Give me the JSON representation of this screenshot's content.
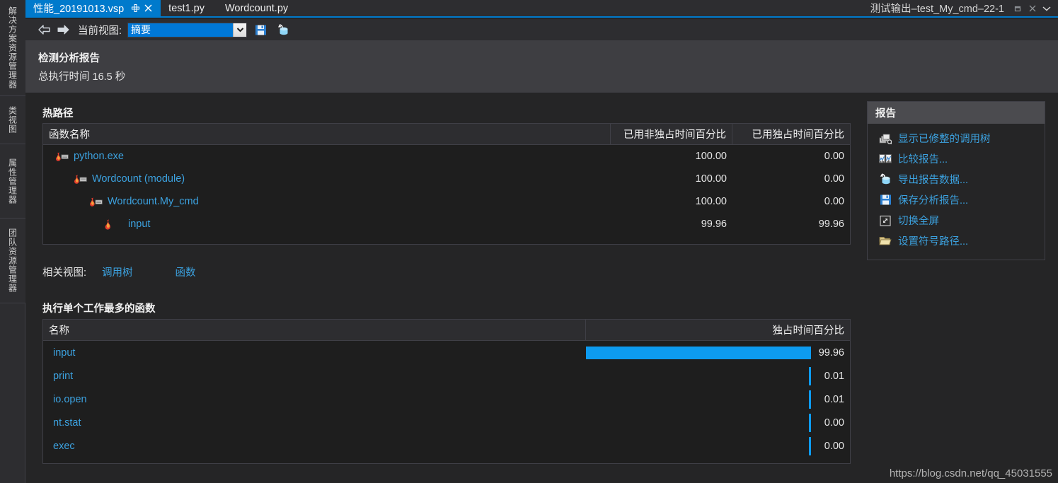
{
  "colors": {
    "accent": "#007acc",
    "link": "#3ca2e0",
    "bar": "#0d9bf0",
    "band": "#3e3e42",
    "content_bg": "#252526",
    "grid_bg": "#1e1e1e"
  },
  "left_dock": {
    "items": [
      {
        "label": "解决方案资源管理器",
        "name": "dock-tab-solution-explorer"
      },
      {
        "label": "类视图",
        "name": "dock-tab-class-view"
      },
      {
        "label": "属性管理器",
        "name": "dock-tab-property-manager"
      },
      {
        "label": "团队资源管理器",
        "name": "dock-tab-team-explorer"
      }
    ]
  },
  "tabbar": {
    "tabs": [
      {
        "label": "性能_20191013.vsp",
        "active": true,
        "pin_icon": "pin-icon",
        "close_icon": "close-icon"
      },
      {
        "label": "test1.py",
        "active": false
      },
      {
        "label": "Wordcount.py",
        "active": false
      }
    ],
    "window_title": "测试输出–test_My_cmd–22-1",
    "window_buttons": [
      {
        "icon": "undock-icon",
        "glyph": "⊐"
      },
      {
        "icon": "close-icon",
        "glyph": "✕"
      },
      {
        "icon": "chevron-down-icon",
        "glyph": "▼"
      }
    ]
  },
  "toolbar": {
    "back_icon": "back-arrow-icon",
    "forward_icon": "forward-arrow-icon",
    "view_label": "当前视图:",
    "view_value": "摘要",
    "view_options": [
      "摘要"
    ],
    "dropdown_icon": "chevron-down-icon",
    "save_icon": "save-icon",
    "export_icon": "export-data-icon"
  },
  "report_band": {
    "title": "检测分析报告",
    "subtitle": "总执行时间 16.5 秒"
  },
  "hot_path": {
    "section_title": "热路径",
    "columns": [
      "函数名称",
      "已用非独占时间百分比",
      "已用独占时间百分比"
    ],
    "rows": [
      {
        "name": "python.exe",
        "indent": 0,
        "icon": "flame-module-icon",
        "inclusive": "100.00",
        "exclusive": "0.00"
      },
      {
        "name": "Wordcount (module)",
        "indent": 1,
        "icon": "flame-module-icon",
        "inclusive": "100.00",
        "exclusive": "0.00"
      },
      {
        "name": "Wordcount.My_cmd",
        "indent": 2,
        "icon": "flame-module-icon",
        "inclusive": "100.00",
        "exclusive": "0.00"
      },
      {
        "name": "input",
        "indent": 3,
        "icon": "flame-icon",
        "inclusive": "99.96",
        "exclusive": "99.96"
      }
    ]
  },
  "related_views": {
    "label": "相关视图:",
    "links": [
      "调用树",
      "函数"
    ]
  },
  "functions": {
    "section_title": "执行单个工作最多的函数",
    "columns": [
      "名称",
      "独占时间百分比"
    ],
    "rows": [
      {
        "name": "input",
        "value": "99.96",
        "pct": 99.96
      },
      {
        "name": "print",
        "value": "0.01",
        "pct": 0.01
      },
      {
        "name": "io.open",
        "value": "0.01",
        "pct": 0.01
      },
      {
        "name": "nt.stat",
        "value": "0.00",
        "pct": 0.0
      },
      {
        "name": "exec",
        "value": "0.00",
        "pct": 0.0
      }
    ]
  },
  "report_pane": {
    "title": "报告",
    "items": [
      {
        "label": "显示已修整的调用树",
        "icon": "call-tree-icon"
      },
      {
        "label": "比较报告...",
        "icon": "compare-reports-icon"
      },
      {
        "label": "导出报告数据...",
        "icon": "export-data-icon"
      },
      {
        "label": "保存分析报告...",
        "icon": "save-icon"
      },
      {
        "label": "切换全屏",
        "icon": "fullscreen-icon"
      },
      {
        "label": "设置符号路径...",
        "icon": "folder-icon"
      }
    ]
  },
  "watermark": "https://blog.csdn.net/qq_45031555",
  "chart_data": {
    "type": "bar",
    "title": "执行单个工作最多的函数",
    "xlabel": "独占时间百分比",
    "ylabel": "名称",
    "categories": [
      "input",
      "print",
      "io.open",
      "nt.stat",
      "exec"
    ],
    "values": [
      99.96,
      0.01,
      0.01,
      0.0,
      0.0
    ],
    "xlim": [
      0,
      100
    ],
    "grid": false,
    "legend": "none",
    "orientation": "horizontal"
  }
}
